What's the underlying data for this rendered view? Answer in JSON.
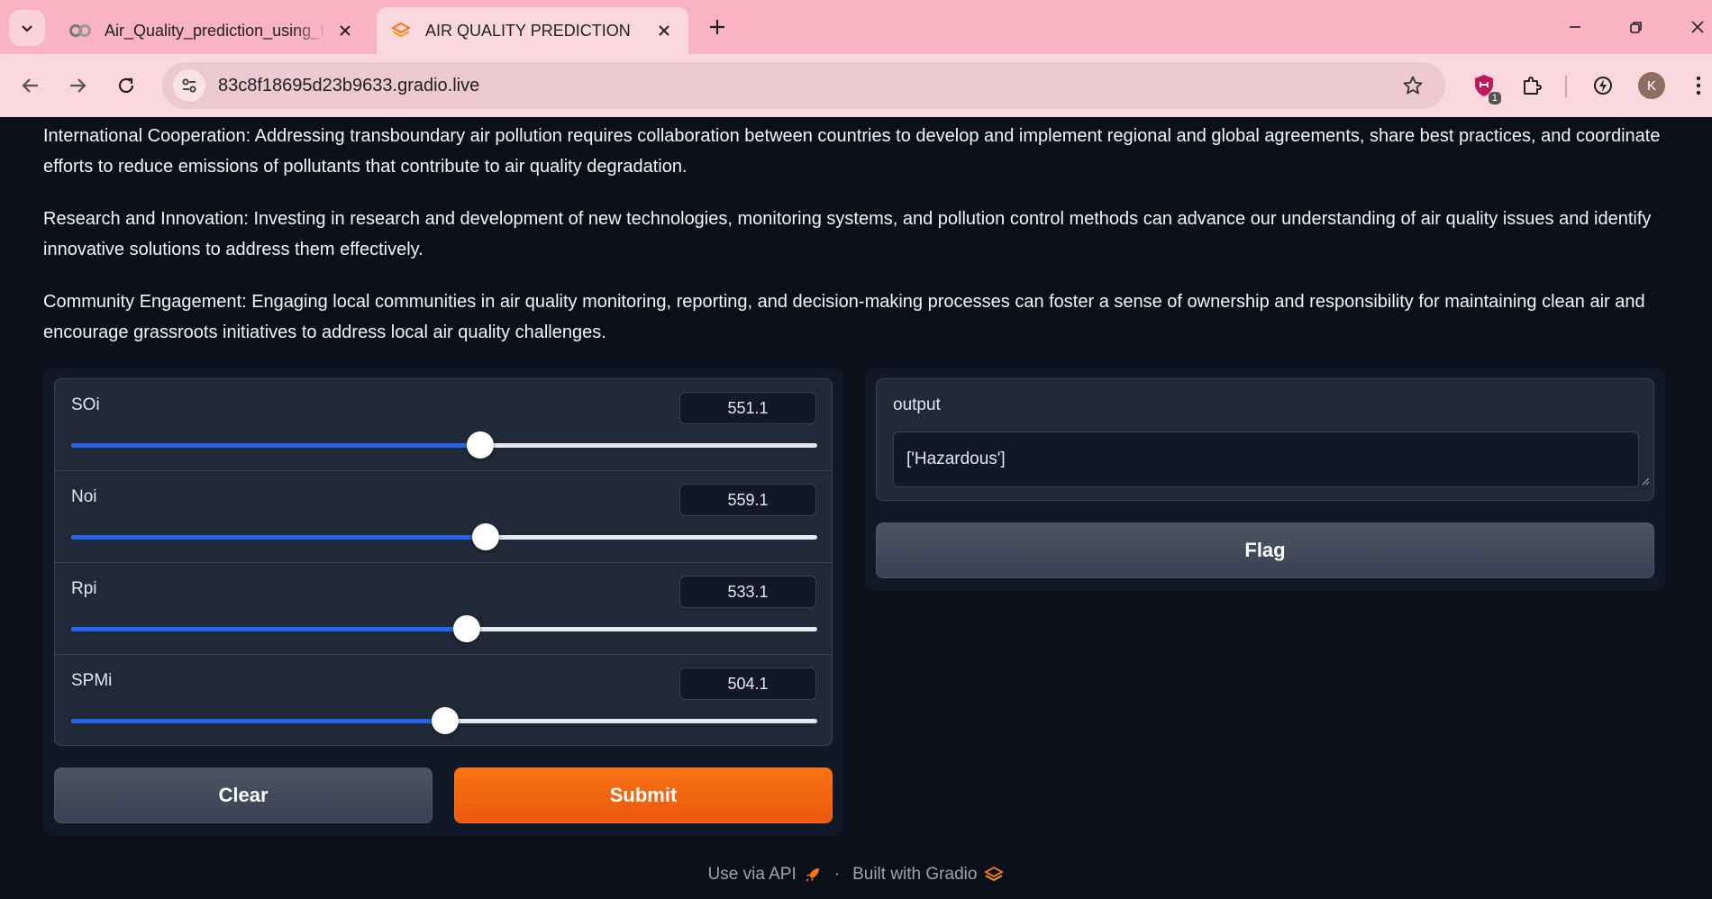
{
  "browser": {
    "tabs": [
      {
        "title": "Air_Quality_prediction_using_Ls",
        "icon": "colab-icon",
        "active": false
      },
      {
        "title": "AIR QUALITY PREDICTION",
        "icon": "gradio-icon",
        "active": true
      }
    ],
    "url": "83c8f18695d23b9633.gradio.live",
    "extension_badge": "1",
    "profile_initial": "K"
  },
  "paragraphs": [
    "International Cooperation: Addressing transboundary air pollution requires collaboration between countries to develop and implement regional and global agreements, share best practices, and coordinate efforts to reduce emissions of pollutants that contribute to air quality degradation.",
    "Research and Innovation: Investing in research and development of new technologies, monitoring systems, and pollution control methods can advance our understanding of air quality issues and identify innovative solutions to address them effectively.",
    "Community Engagement: Engaging local communities in air quality monitoring, reporting, and decision-making processes can foster a sense of ownership and responsibility for maintaining clean air and encourage grassroots initiatives to address local air quality challenges."
  ],
  "sliders": [
    {
      "label": "SOi",
      "value": "551.1",
      "fraction": 0.548
    },
    {
      "label": "Noi",
      "value": "559.1",
      "fraction": 0.556
    },
    {
      "label": "Rpi",
      "value": "533.1",
      "fraction": 0.53
    },
    {
      "label": "SPMi",
      "value": "504.1",
      "fraction": 0.501
    }
  ],
  "buttons": {
    "clear": "Clear",
    "submit": "Submit",
    "flag": "Flag"
  },
  "output": {
    "label": "output",
    "value": "['Hazardous']"
  },
  "footer": {
    "api": "Use via API",
    "separator": "·",
    "built": "Built with Gradio"
  },
  "colors": {
    "accent": "#2563eb",
    "primary": "#f97316",
    "background": "#0b0f19",
    "tabbar": "#f9b3c3"
  }
}
